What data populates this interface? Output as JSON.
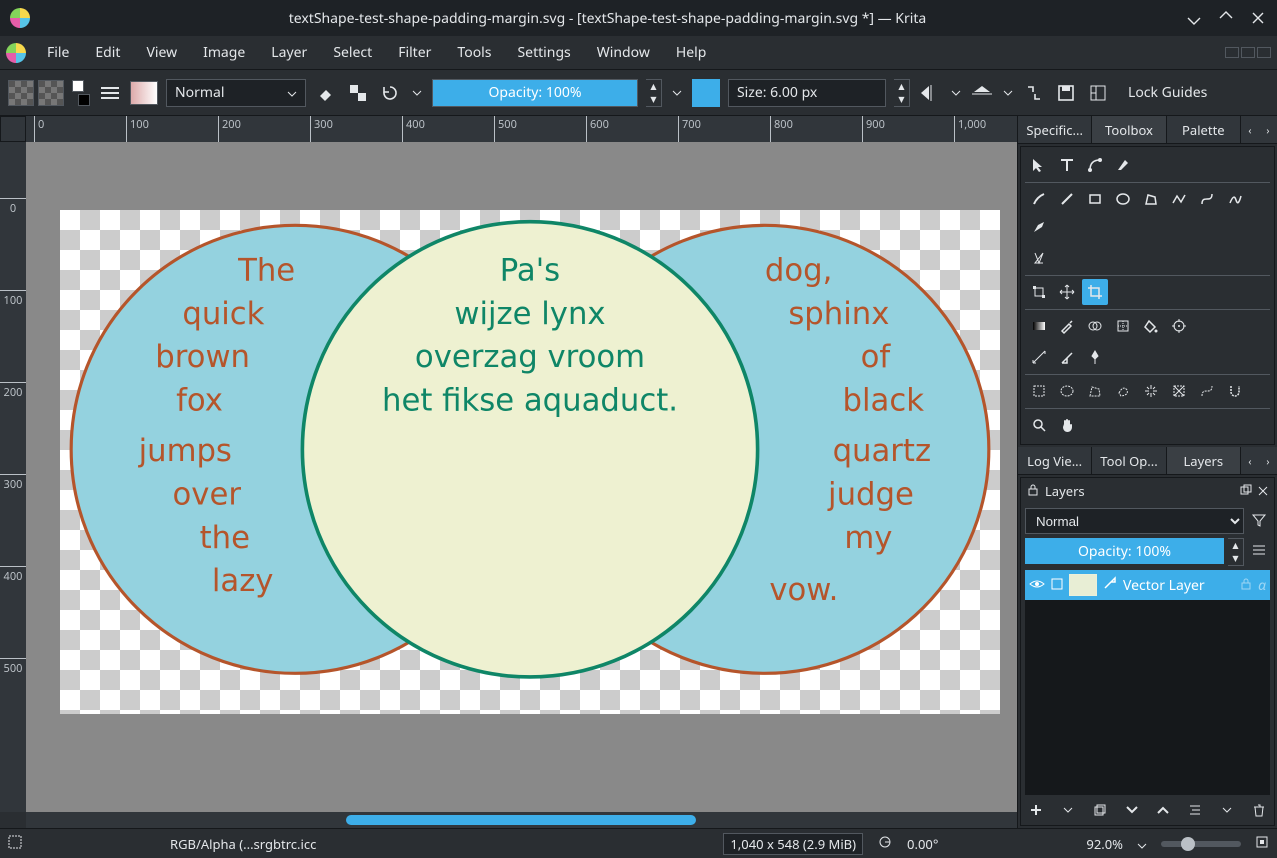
{
  "titlebar": {
    "title": "textShape-test-shape-padding-margin.svg - [textShape-test-shape-padding-margin.svg *] — Krita"
  },
  "menu": {
    "items": [
      "File",
      "Edit",
      "View",
      "Image",
      "Layer",
      "Select",
      "Filter",
      "Tools",
      "Settings",
      "Window",
      "Help"
    ]
  },
  "toolbar": {
    "blend_mode": "Normal",
    "opacity_label": "Opacity: 100%",
    "size_label": "Size: 6.00 px",
    "lock_guides": "Lock Guides"
  },
  "ruler": {
    "h_ticks": [
      "0",
      "100",
      "200",
      "300",
      "400",
      "500",
      "600",
      "700",
      "800",
      "900",
      "1,000"
    ],
    "v_ticks": [
      "0",
      "100",
      "200",
      "300",
      "400",
      "500"
    ]
  },
  "canvas": {
    "left_text_lines": [
      "The",
      "quick",
      "brown",
      "fox",
      "jumps",
      "over",
      "the",
      "lazy"
    ],
    "center_text_lines": [
      "Pa's",
      "wijze lynx",
      "overzag vroom",
      "het fikse aquaduct."
    ],
    "right_text_lines": [
      "dog,",
      "sphinx",
      "of",
      "black",
      "quartz",
      "judge",
      "my",
      "vow."
    ]
  },
  "right_tabs_top": {
    "items": [
      "Specific...",
      "Toolbox",
      "Palette"
    ],
    "active_index": 1
  },
  "right_tabs_mid": {
    "items": [
      "Log Vie...",
      "Tool Op...",
      "Layers"
    ],
    "active_index": 2
  },
  "layers": {
    "title": "Layers",
    "blend_mode": "Normal",
    "opacity_label": "Opacity:  100%",
    "layer0": {
      "name": "Vector Layer"
    }
  },
  "statusbar": {
    "selection_icon": "",
    "color_info": "RGB/Alpha (...srgbtrc.icc",
    "dims": "1,040 x 548 (2.9 MiB)",
    "rotation": "0.00°",
    "zoom": "92.0%"
  }
}
